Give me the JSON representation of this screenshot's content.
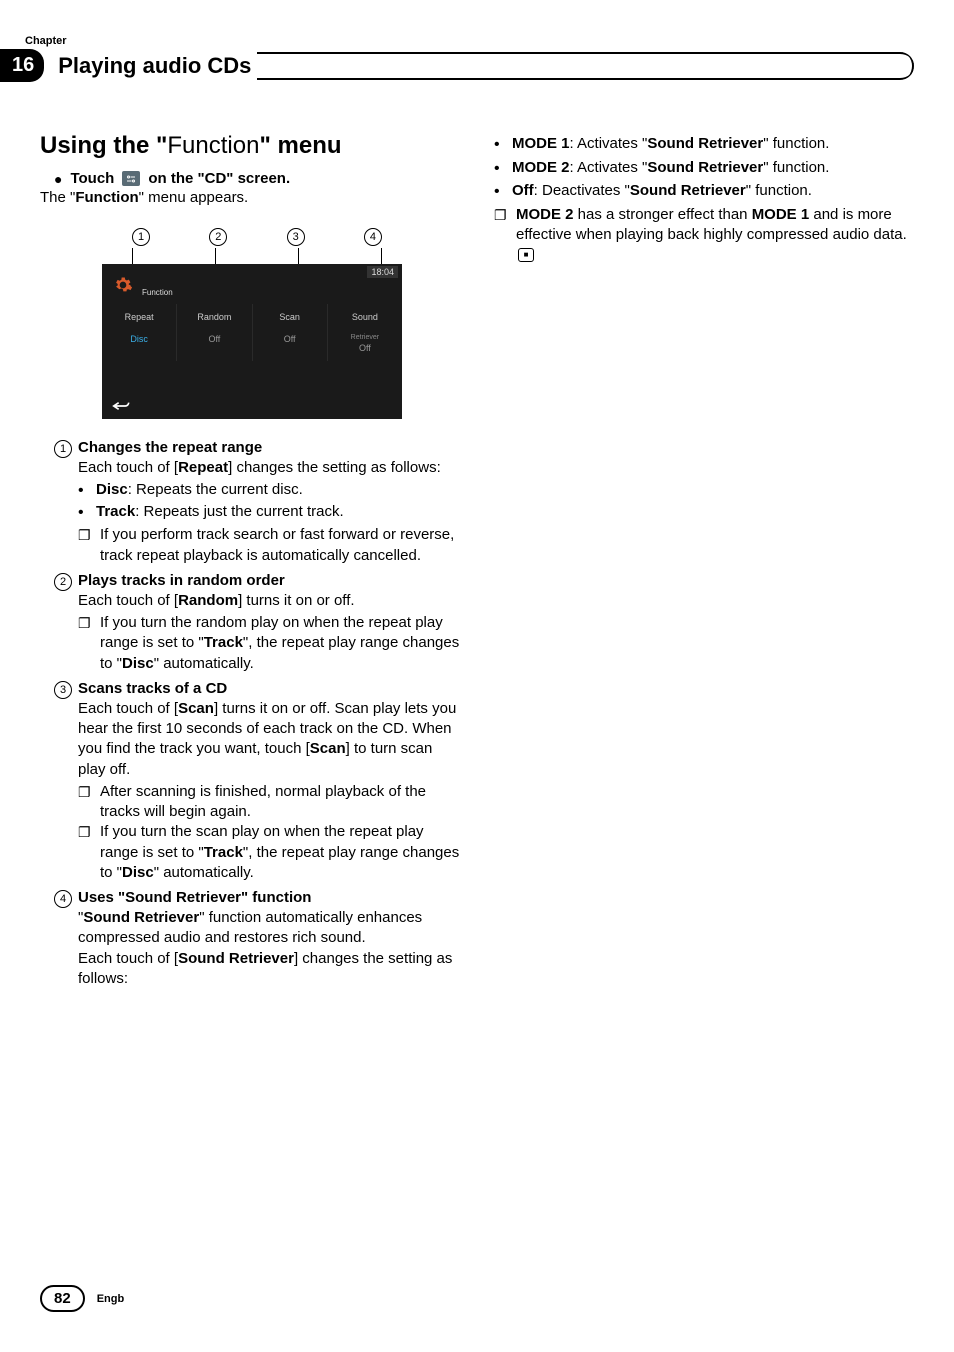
{
  "chapter": {
    "label": "Chapter",
    "number": "16",
    "title": "Playing audio CDs"
  },
  "section": {
    "title_prefix": "Using the \"",
    "title_word": "Function",
    "title_suffix": "\" menu",
    "touch_prefix": "Touch ",
    "touch_suffix": " on the \"CD\" screen.",
    "appears_prefix": "The \"",
    "appears_word": "Function",
    "appears_suffix": "\" menu appears."
  },
  "callouts": [
    "1",
    "2",
    "3",
    "4"
  ],
  "screen": {
    "function_label": "Function",
    "time": "18:04",
    "cols": [
      {
        "title": "Repeat",
        "sub": "",
        "val": "Disc",
        "val_class": "blue"
      },
      {
        "title": "Random",
        "sub": "",
        "val": "Off",
        "val_class": "grey"
      },
      {
        "title": "Scan",
        "sub": "",
        "val": "Off",
        "val_class": "grey"
      },
      {
        "title": "Sound",
        "sub": "Retriever",
        "val": "Off",
        "val_class": "grey"
      }
    ]
  },
  "items": [
    {
      "num": "1",
      "heading": "Changes the repeat range",
      "body_pre": "Each touch of [",
      "body_bold": "Repeat",
      "body_post": "] changes the setting as follows:",
      "dots": [
        {
          "bold": "Disc",
          "text": ": Repeats the current disc."
        },
        {
          "bold": "Track",
          "text": ": Repeats just the current track."
        }
      ],
      "boxes": [
        {
          "text": "If you perform track search or fast forward or reverse, track repeat playback is automatically cancelled."
        }
      ]
    },
    {
      "num": "2",
      "heading": "Plays tracks in random order",
      "body_pre": "Each touch of [",
      "body_bold": "Random",
      "body_post": "]  turns it on or off.",
      "boxes": [
        {
          "pre": "If you turn the random play on when the repeat play range is set to \"",
          "b1": "Track",
          "mid": "\", the repeat play range changes to \"",
          "b2": "Disc",
          "post": "\" automatically."
        }
      ]
    },
    {
      "num": "3",
      "heading": "Scans tracks of a CD",
      "body_pre": "Each touch of [",
      "body_bold": "Scan",
      "body_mid": "] turns it on or off. Scan play lets you hear the first 10 seconds of each track on the CD. When you find the track you want, touch [",
      "body_bold2": "Scan",
      "body_post": "] to turn scan play off.",
      "boxes": [
        {
          "text": "After scanning is finished, normal playback of the tracks will begin again."
        },
        {
          "pre": "If you turn the scan play on when the repeat play range is set to \"",
          "b1": "Track",
          "mid": "\", the repeat play range changes to \"",
          "b2": "Disc",
          "post": "\" automatically."
        }
      ]
    },
    {
      "num": "4",
      "heading": "Uses \"Sound Retriever\" function",
      "body_pre": "\"",
      "body_bold": "Sound Retriever",
      "body_post": "\" function automatically enhances compressed audio and restores rich sound.",
      "body2_pre": "Each touch of [",
      "body2_bold": "Sound Retriever",
      "body2_post": "] changes the setting as follows:"
    }
  ],
  "col2": {
    "dots": [
      {
        "bold": "MODE 1",
        "mid": ": Activates \"",
        "b2": "Sound Retriever",
        "post": "\" function."
      },
      {
        "bold": "MODE 2",
        "mid": ": Activates \"",
        "b2": "Sound Retriever",
        "post": "\" function."
      },
      {
        "bold": "Off",
        "mid": ": Deactivates \"",
        "b2": "Sound Retriever",
        "post": "\" function."
      }
    ],
    "box": {
      "b1": "MODE 2",
      "t1": " has a stronger effect than ",
      "b2": "MODE 1",
      "t2": " and is more effective when playing back highly compressed audio data."
    }
  },
  "footer": {
    "page": "82",
    "lang": "Engb"
  }
}
